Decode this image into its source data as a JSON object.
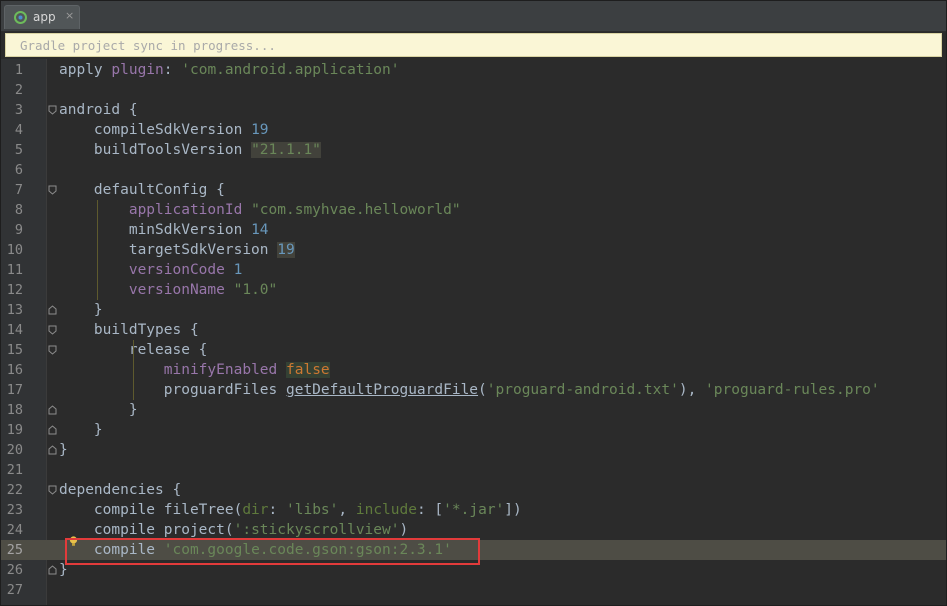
{
  "tab": {
    "label": "app",
    "close": "×",
    "icon": "gradle-project-icon"
  },
  "notification": {
    "text": "Gradle project sync in progress..."
  },
  "editor": {
    "current_line": 25,
    "lines": [
      {
        "n": "1",
        "segs": [
          [
            "plain",
            "apply "
          ],
          [
            "purple",
            "plugin"
          ],
          [
            "plain",
            ": "
          ],
          [
            "str",
            "'com.android.application'"
          ]
        ]
      },
      {
        "n": "2",
        "segs": []
      },
      {
        "n": "3",
        "segs": [
          [
            "plain",
            "android {"
          ]
        ]
      },
      {
        "n": "4",
        "segs": [
          [
            "plain",
            "    compileSdkVersion "
          ],
          [
            "num",
            "19"
          ]
        ]
      },
      {
        "n": "5",
        "segs": [
          [
            "plain",
            "    buildToolsVersion "
          ],
          [
            "strhl",
            "\"21.1.1\""
          ]
        ]
      },
      {
        "n": "6",
        "segs": []
      },
      {
        "n": "7",
        "segs": [
          [
            "plain",
            "    defaultConfig {"
          ]
        ]
      },
      {
        "n": "8",
        "segs": [
          [
            "plain",
            "        "
          ],
          [
            "purple",
            "applicationId"
          ],
          [
            "plain",
            " "
          ],
          [
            "str",
            "\"com.smyhvae.helloworld\""
          ]
        ]
      },
      {
        "n": "9",
        "segs": [
          [
            "plain",
            "        minSdkVersion "
          ],
          [
            "num",
            "14"
          ]
        ]
      },
      {
        "n": "10",
        "segs": [
          [
            "plain",
            "        targetSdkVersion "
          ],
          [
            "numhl",
            "19"
          ]
        ]
      },
      {
        "n": "11",
        "segs": [
          [
            "plain",
            "        "
          ],
          [
            "purple",
            "versionCode"
          ],
          [
            "plain",
            " "
          ],
          [
            "num",
            "1"
          ]
        ]
      },
      {
        "n": "12",
        "segs": [
          [
            "plain",
            "        "
          ],
          [
            "purple",
            "versionName"
          ],
          [
            "plain",
            " "
          ],
          [
            "str",
            "\"1.0\""
          ]
        ]
      },
      {
        "n": "13",
        "segs": [
          [
            "plain",
            "    }"
          ]
        ]
      },
      {
        "n": "14",
        "segs": [
          [
            "plain",
            "    buildTypes {"
          ]
        ]
      },
      {
        "n": "15",
        "segs": [
          [
            "plain",
            "        release {"
          ]
        ]
      },
      {
        "n": "16",
        "segs": [
          [
            "plain",
            "            "
          ],
          [
            "purple",
            "minifyEnabled"
          ],
          [
            "plain",
            " "
          ],
          [
            "false",
            "false"
          ]
        ]
      },
      {
        "n": "17",
        "segs": [
          [
            "plain",
            "            proguardFiles "
          ],
          [
            "fn",
            "getDefaultProguardFile"
          ],
          [
            "plain",
            "("
          ],
          [
            "str",
            "'proguard-android.txt'"
          ],
          [
            "plain",
            "), "
          ],
          [
            "str",
            "'proguard-rules.pro'"
          ]
        ]
      },
      {
        "n": "18",
        "segs": [
          [
            "plain",
            "        }"
          ]
        ]
      },
      {
        "n": "19",
        "segs": [
          [
            "plain",
            "    }"
          ]
        ]
      },
      {
        "n": "20",
        "segs": [
          [
            "plain",
            "}"
          ]
        ]
      },
      {
        "n": "21",
        "segs": []
      },
      {
        "n": "22",
        "segs": [
          [
            "plain",
            "dependencies {"
          ]
        ]
      },
      {
        "n": "23",
        "segs": [
          [
            "plain",
            "    compile fileTree("
          ],
          [
            "param",
            "dir"
          ],
          [
            "plain",
            ": "
          ],
          [
            "str",
            "'libs'"
          ],
          [
            "plain",
            ", "
          ],
          [
            "param",
            "include"
          ],
          [
            "plain",
            ": ["
          ],
          [
            "str",
            "'*.jar'"
          ],
          [
            "plain",
            "])"
          ]
        ]
      },
      {
        "n": "24",
        "segs": [
          [
            "plain",
            "    compile project("
          ],
          [
            "str",
            "':stickyscrollview'"
          ],
          [
            "plain",
            ")"
          ]
        ]
      },
      {
        "n": "25",
        "segs": [
          [
            "plain",
            "    compile "
          ],
          [
            "str",
            "'com.google.code.gson:gson:2.3.1'"
          ]
        ]
      },
      {
        "n": "26",
        "segs": [
          [
            "plain",
            "}"
          ]
        ]
      },
      {
        "n": "27",
        "segs": []
      }
    ]
  },
  "colors": {
    "background": "#2b2b2b",
    "gutter": "#313335",
    "current_line": "#4e4d45",
    "highlight_box": "#e23b3b",
    "notification_bg": "#faf6d6"
  }
}
